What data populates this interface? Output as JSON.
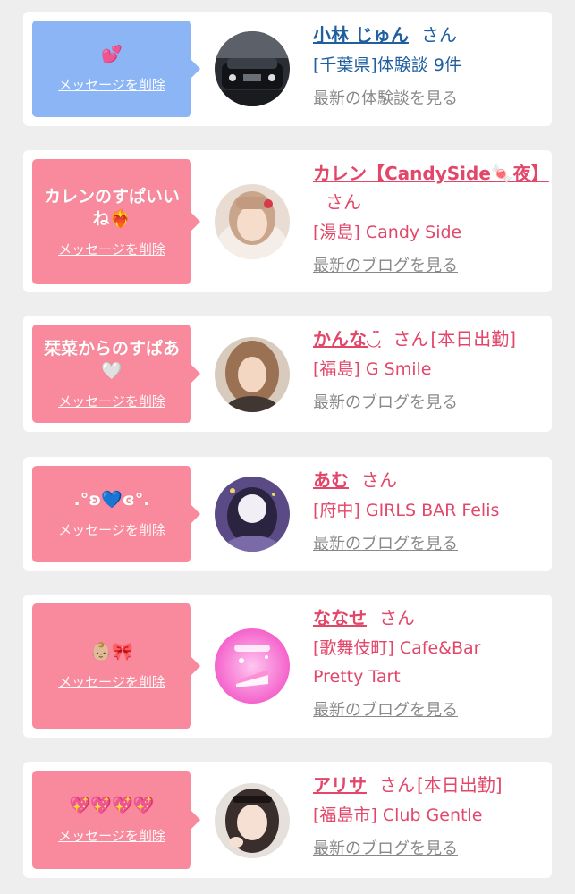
{
  "delete_label": "メッセージを削除",
  "items": [
    {
      "message": "💕",
      "name": "小林 じゅん",
      "honorific": "さん",
      "status": "",
      "shop": "[千葉県]体験談 9件",
      "link": "最新の体験談を見る",
      "bubble_color": "#8bb5f5",
      "text_color": "#1f5fa0",
      "avatar_icon": "car-photo-icon"
    },
    {
      "message": "カレンのすぱいいね❤️‍🔥",
      "name": "カレン【CandySide🍬夜】",
      "honorific": "さん",
      "status": "",
      "shop": "[湯島] Candy Side",
      "link": "最新のブログを見る",
      "bubble_color": "#f9899c",
      "text_color": "#e2476a",
      "avatar_icon": "girl-photo-icon"
    },
    {
      "message": "栞菜からのすぱあ🤍",
      "name": "かんな◡̈",
      "honorific": "さん",
      "status": "[本日出勤]",
      "shop": "[福島] G Smile",
      "link": "最新のブログを見る",
      "bubble_color": "#f9899c",
      "text_color": "#e2476a",
      "avatar_icon": "girl-photo-icon"
    },
    {
      "message": ".°ʚ💙ɞ°.",
      "name": "あむ",
      "honorific": "さん",
      "status": "",
      "shop": "[府中] GIRLS BAR Felis",
      "link": "最新のブログを見る",
      "bubble_color": "#f9899c",
      "text_color": "#e2476a",
      "avatar_icon": "blurred-girl-photo-icon"
    },
    {
      "message": "👶🏼🎀",
      "name": "ななせ",
      "honorific": "さん",
      "status": "",
      "shop": "[歌舞伎町] Cafe&Bar\nPretty Tart",
      "link": "最新のブログを見る",
      "bubble_color": "#f9899c",
      "text_color": "#e2476a",
      "avatar_icon": "cake-icon"
    },
    {
      "message": "💖💖💖💖",
      "name": "アリサ",
      "honorific": "さん",
      "status": "[本日出勤]",
      "shop": "[福島市] Club Gentle",
      "link": "最新のブログを見る",
      "bubble_color": "#f9899c",
      "text_color": "#e2476a",
      "avatar_icon": "girl-photo-icon"
    }
  ]
}
